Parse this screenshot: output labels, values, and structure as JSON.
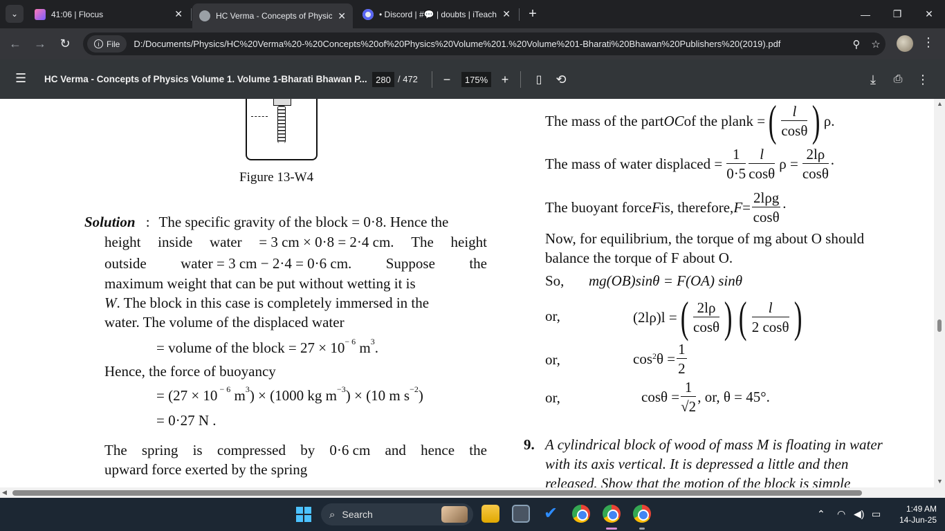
{
  "browser": {
    "tabs": [
      {
        "title": "41:06 | Flocus",
        "active": false
      },
      {
        "title": "HC Verma - Concepts of Physic",
        "active": true
      },
      {
        "title": "• Discord | #💬 | doubts | iTeach",
        "active": false
      }
    ],
    "url_chip": "File",
    "url": "D:/Documents/Physics/HC%20Verma%20-%20Concepts%20of%20Physics%20Volume%201.%20Volume%201-Bharati%20Bhawan%20Publishers%20(2019).pdf"
  },
  "pdf_toolbar": {
    "title": "HC Verma - Concepts of Physics Volume 1. Volume 1-Bharati Bhawan P...",
    "page_current": "280",
    "page_total": "/ 472",
    "zoom": "175%"
  },
  "document": {
    "figure_caption": "Figure 13-W4",
    "solution_label": "Solution",
    "colon": ":",
    "left": {
      "line1": "The specific gravity of the block = 0·8. Hence the",
      "line2_words": [
        "height",
        "inside",
        "water",
        "= 3 cm × 0·8 = 2·4 cm.",
        "The",
        "height"
      ],
      "line3_words": [
        "outside",
        "water = 3 cm − 2·4 = 0·6 cm.",
        "Suppose",
        "the"
      ],
      "line4": "maximum weight that can be put without wetting it is",
      "line5_var": "W",
      "line5": ". The block in this case is completely immersed in the",
      "line6": "water. The volume of the displaced water",
      "line7": "= volume  of  the  block = 27 × 10",
      "line7_exp": "− 6",
      "line7_unit": " m",
      "line7_unit_exp": "3",
      "line7_end": ".",
      "line8": "Hence, the force of  buoyancy",
      "line9_a": "= (27 × 10",
      "line9_e1": " − 6",
      "line9_b": " m",
      "line9_e2": "3",
      "line9_c": ") × (1000 kg m",
      "line9_e3": "−3",
      "line9_d": ") × (10 m s",
      "line9_e4": "−2",
      "line9_f": ")",
      "line10": "= 0·27 N .",
      "line11_words": [
        "The",
        "spring",
        "is",
        "compressed",
        "by",
        "0·6 cm",
        "and",
        "hence",
        "the"
      ],
      "line12": "upward force exerted by the spring"
    },
    "right": {
      "r1_text": "The mass of the part ",
      "r1_var": "OC",
      "r1_text2": " of the plank =",
      "r1_num": "l",
      "r1_den": "cosθ",
      "r1_end": "ρ.",
      "r2_text": "The mass of water displaced =",
      "r2_f1n": "1",
      "r2_f1d": "0·5",
      "r2_f2n": "l",
      "r2_f2d": "cosθ",
      "r2_mid": "ρ =",
      "r2_f3n": "2lρ",
      "r2_f3d": "cosθ",
      "r2_end": "·",
      "r3_text": "The buoyant force ",
      "r3_var": "F",
      "r3_text2": " is, therefore, ",
      "r3_var2": "F",
      "r3_eq": " =",
      "r3_num": "2lρg",
      "r3_den": "cosθ",
      "r3_end": "·",
      "r4": "Now, for equilibrium, the torque of mg about O should",
      "r5": "balance the torque of F about O.",
      "r6_label": "So,",
      "r6_eq": "mg(OB)sinθ = F(OA) sinθ",
      "r7_label": "or,",
      "r7_lhs": "(2lρ)l =",
      "r7_f1n": "2lρ",
      "r7_f1d": "cosθ",
      "r7_f2n": "l",
      "r7_f2d": "2 cosθ",
      "r8_label": "or,",
      "r8_lhs": "cos",
      "r8_exp": "2",
      "r8_lhs2": "θ =",
      "r8_n": "1",
      "r8_d": "2",
      "r9_label": "or,",
      "r9_lhs": "cosθ =",
      "r9_n": "1",
      "r9_d": "√2",
      "r9_end": " ,  or,  θ = 45°.",
      "q_num": "9.",
      "q1": "A cylindrical block of wood of mass M is floating in water",
      "q2": "with its axis vertical. It is depressed a little and then",
      "q3": "released. Show that the motion of the block is simple"
    }
  },
  "taskbar": {
    "search": "Search",
    "time": "1:49 AM",
    "date": "14-Jun-25"
  },
  "colors": {
    "tab_active": "#35363a",
    "pdf_toolbar": "#323639",
    "taskbar": "#1c2733"
  }
}
